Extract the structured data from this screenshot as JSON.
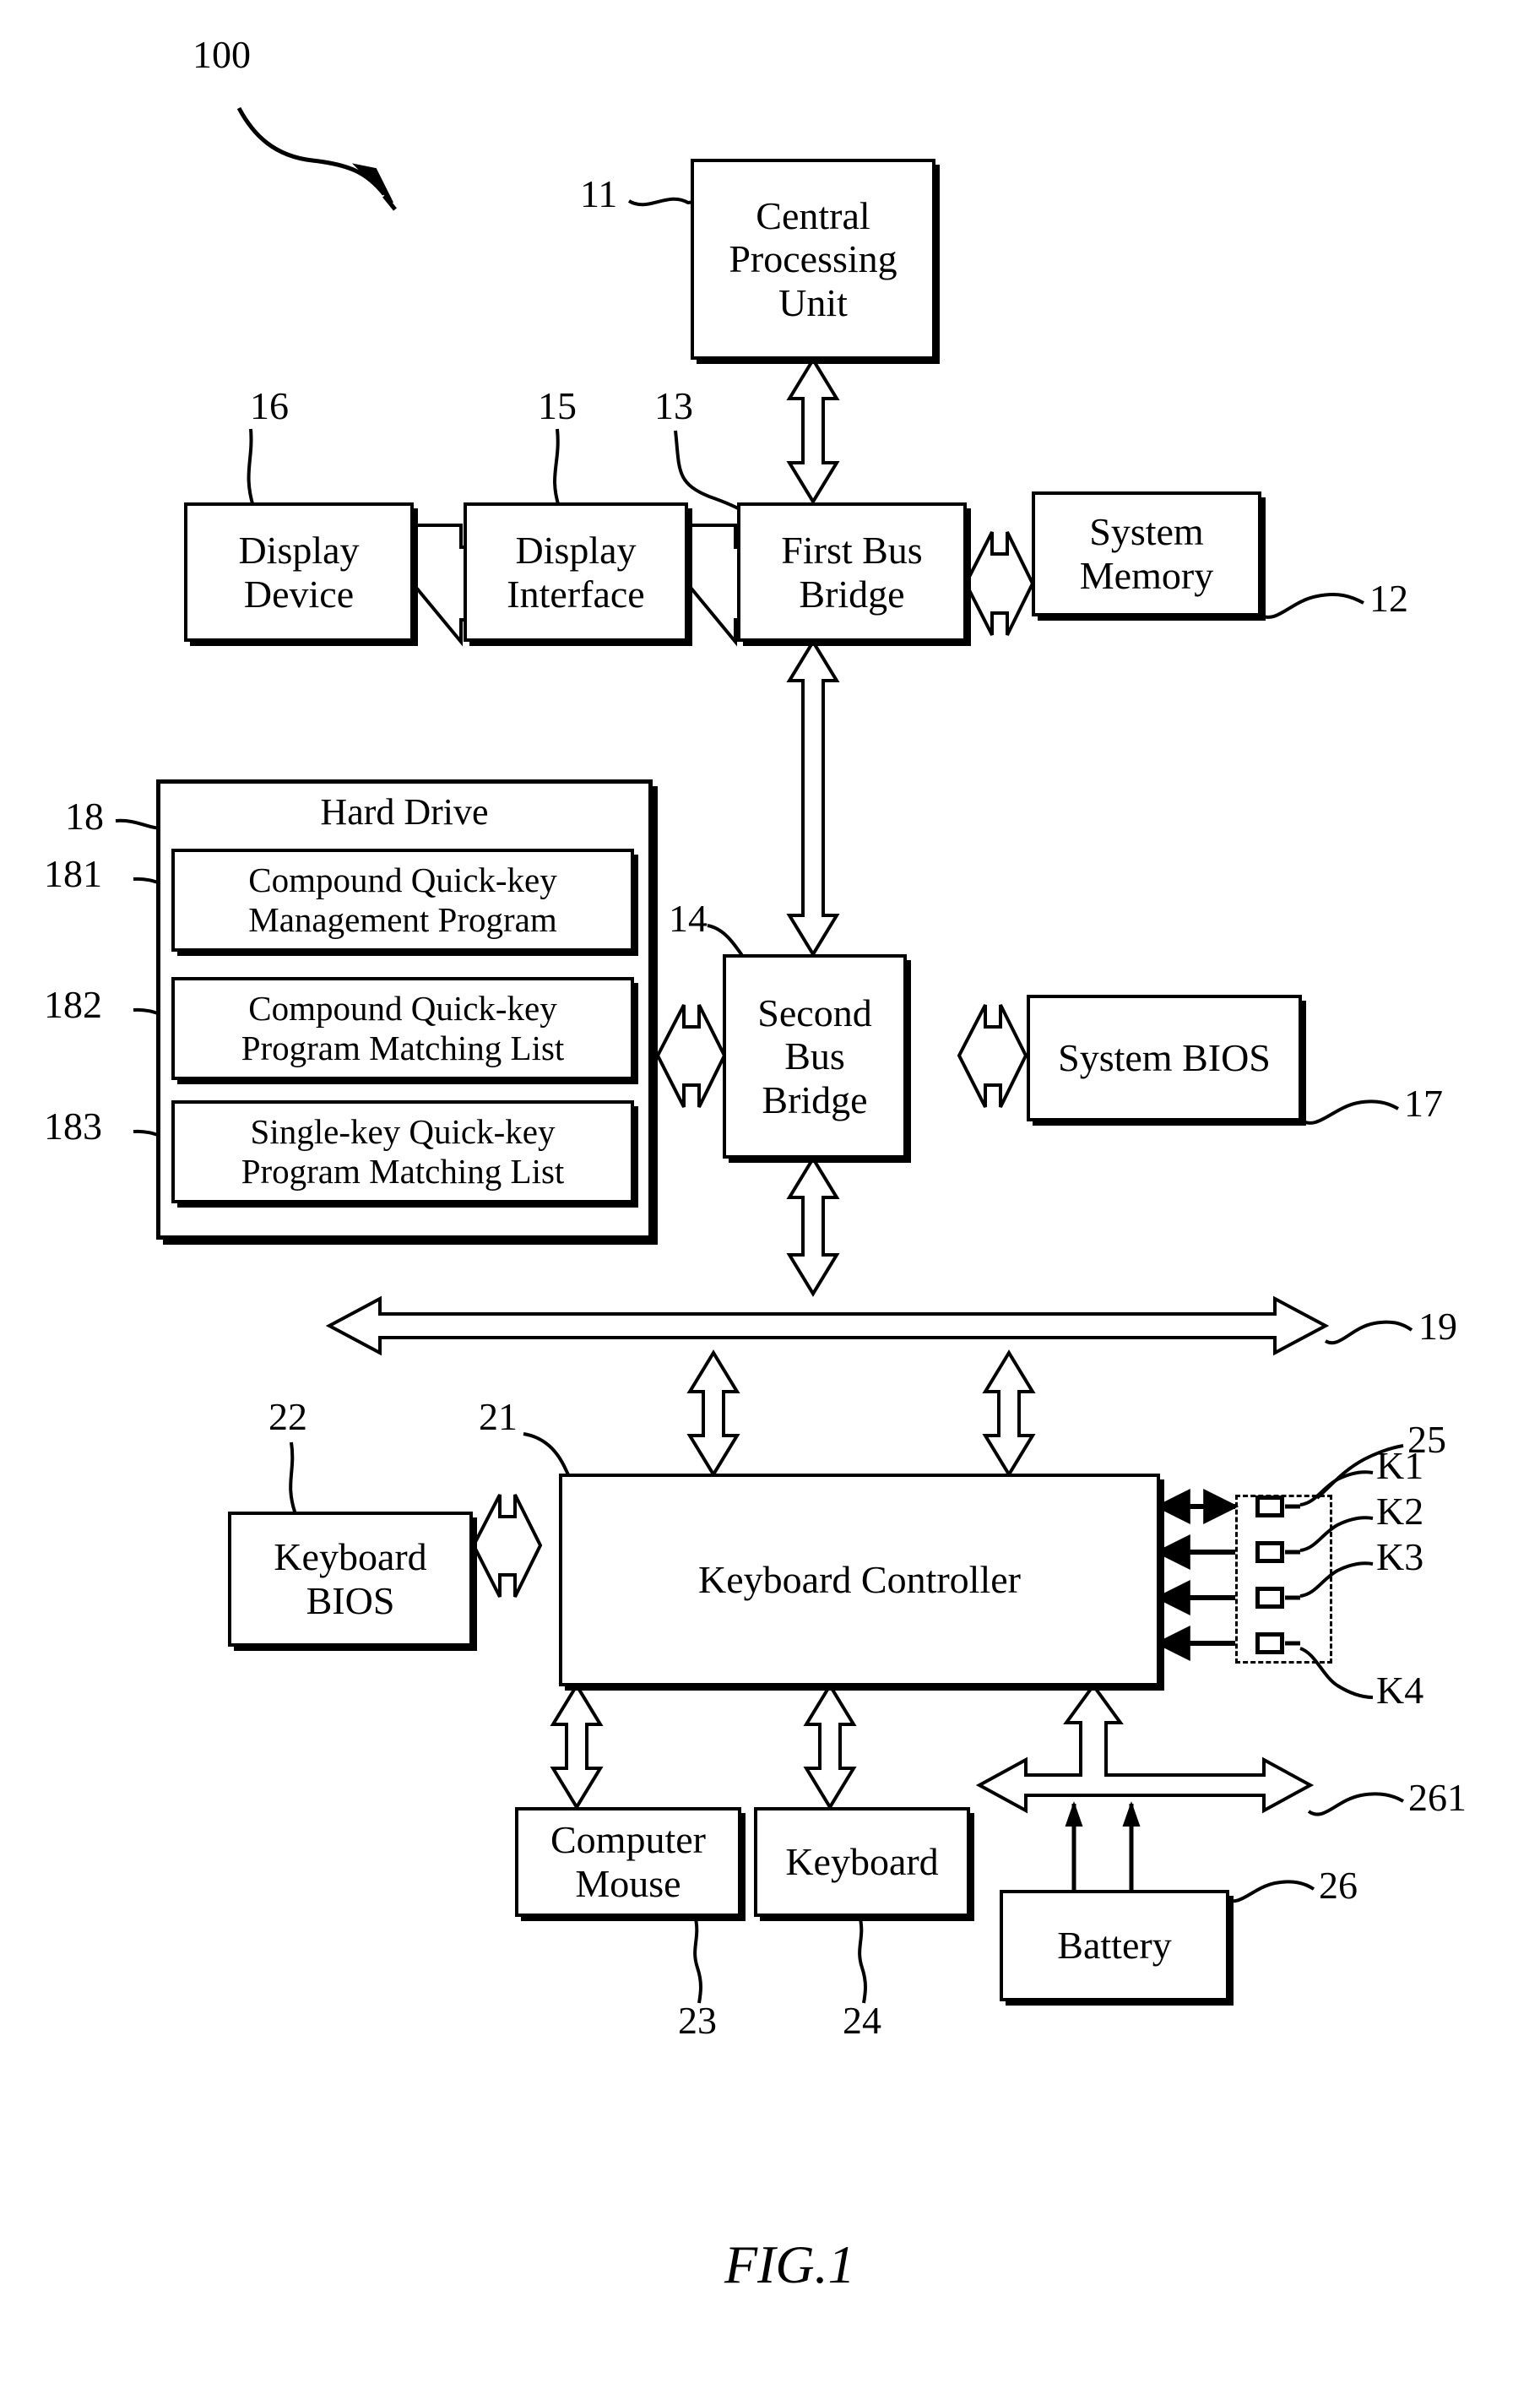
{
  "figure": {
    "caption": "FIG.1",
    "system_numeral": "100"
  },
  "blocks": {
    "cpu": {
      "label": "Central\nProcessing\nUnit",
      "numeral": "11"
    },
    "display_device": {
      "label": "Display\nDevice",
      "numeral": "16"
    },
    "display_interface": {
      "label": "Display\nInterface",
      "numeral": "15"
    },
    "first_bus_bridge": {
      "label": "First Bus\nBridge",
      "numeral": "13"
    },
    "system_memory": {
      "label": "System\nMemory",
      "numeral": "12"
    },
    "hard_drive": {
      "label": "Hard Drive",
      "numeral": "18",
      "items": [
        {
          "label": "Compound Quick-key\nManagement Program",
          "numeral": "181"
        },
        {
          "label": "Compound Quick-key\nProgram Matching List",
          "numeral": "182"
        },
        {
          "label": "Single-key Quick-key\nProgram Matching List",
          "numeral": "183"
        }
      ]
    },
    "second_bus_bridge": {
      "label": "Second\nBus\nBridge",
      "numeral": "14"
    },
    "system_bios": {
      "label": "System BIOS",
      "numeral": "17"
    },
    "system_bus": {
      "numeral": "19"
    },
    "keyboard_bios": {
      "label": "Keyboard\nBIOS",
      "numeral": "22"
    },
    "keyboard_controller": {
      "label": "Keyboard Controller",
      "numeral": "21"
    },
    "computer_mouse": {
      "label": "Computer\nMouse",
      "numeral": "23"
    },
    "keyboard": {
      "label": "Keyboard",
      "numeral": "24"
    },
    "battery": {
      "label": "Battery",
      "numeral": "26"
    },
    "power_bus": {
      "numeral": "261"
    },
    "key_group": {
      "numeral": "25",
      "keys": [
        {
          "label": "K1"
        },
        {
          "label": "K2"
        },
        {
          "label": "K3"
        },
        {
          "label": "K4"
        }
      ]
    }
  },
  "colors": {
    "ink": "#000000",
    "paper": "#ffffff"
  }
}
